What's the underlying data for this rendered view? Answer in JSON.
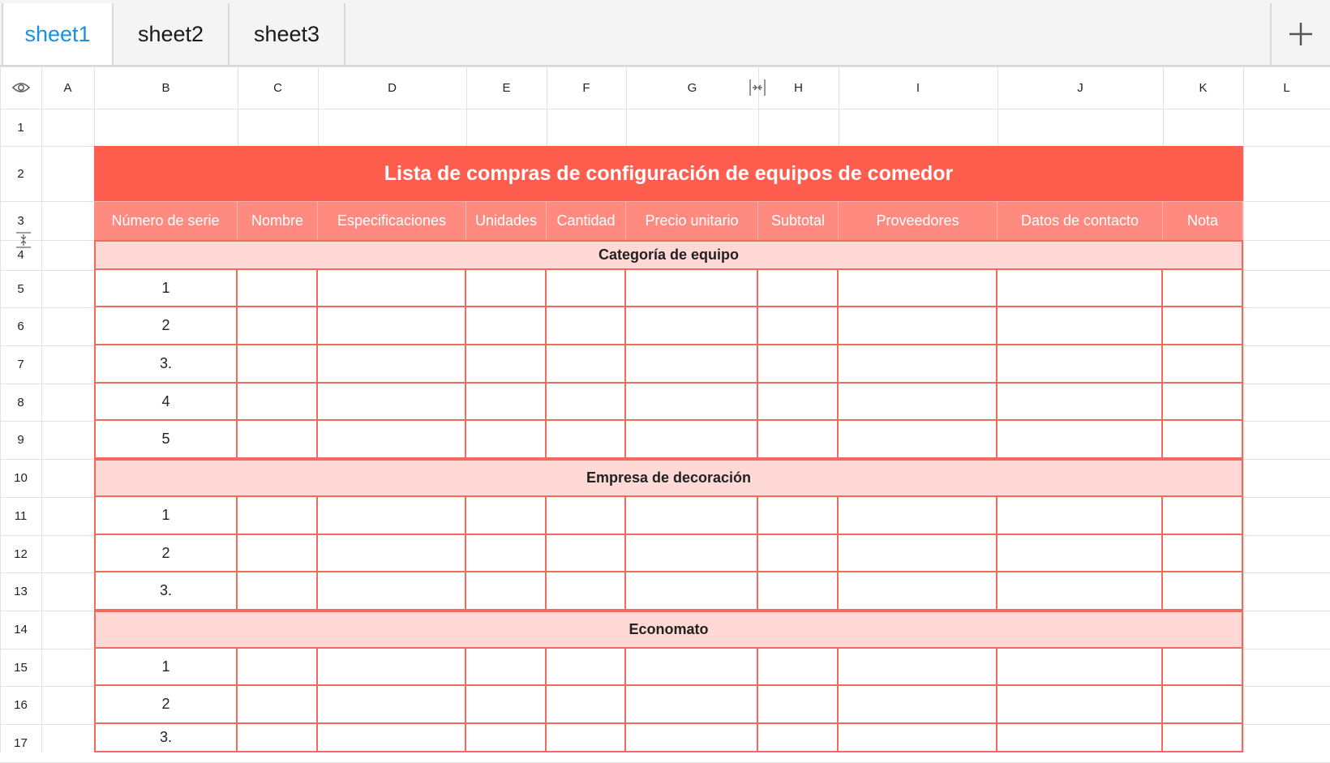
{
  "tabs": [
    {
      "label": "sheet1",
      "active": true
    },
    {
      "label": "sheet2",
      "active": false
    },
    {
      "label": "sheet3",
      "active": false
    }
  ],
  "add_tab_icon": "plus-icon",
  "column_headers": [
    "A",
    "B",
    "C",
    "D",
    "E",
    "F",
    "G",
    "H",
    "I",
    "J",
    "K",
    "L"
  ],
  "row_headers": [
    "1",
    "2",
    "3",
    "4",
    "5",
    "6",
    "7",
    "8",
    "9",
    "10",
    "11",
    "12",
    "13",
    "14",
    "15",
    "16",
    "17"
  ],
  "sheet": {
    "title": "Lista de compras de configuración de equipos de comedor",
    "table_headers": [
      "Número de serie",
      "Nombre",
      "Especificaciones",
      "Unidades",
      "Cantidad",
      "Precio unitario",
      "Subtotal",
      "Proveedores",
      "Datos de contacto",
      "Nota"
    ],
    "sections": [
      {
        "name": "Categoría de equipo",
        "serials": [
          "1",
          "2",
          "3.",
          "4",
          "5"
        ]
      },
      {
        "name": "Empresa de decoración",
        "serials": [
          "1",
          "2",
          "3."
        ]
      },
      {
        "name": "Economato",
        "serials": [
          "1",
          "2",
          "3."
        ]
      }
    ]
  },
  "colors": {
    "title_band": "#ff5e4f",
    "header_band": "#ff8b80",
    "section_band": "#ffd9d5",
    "cell_border": "#f06a5d",
    "active_tab": "#1a8fe0"
  }
}
